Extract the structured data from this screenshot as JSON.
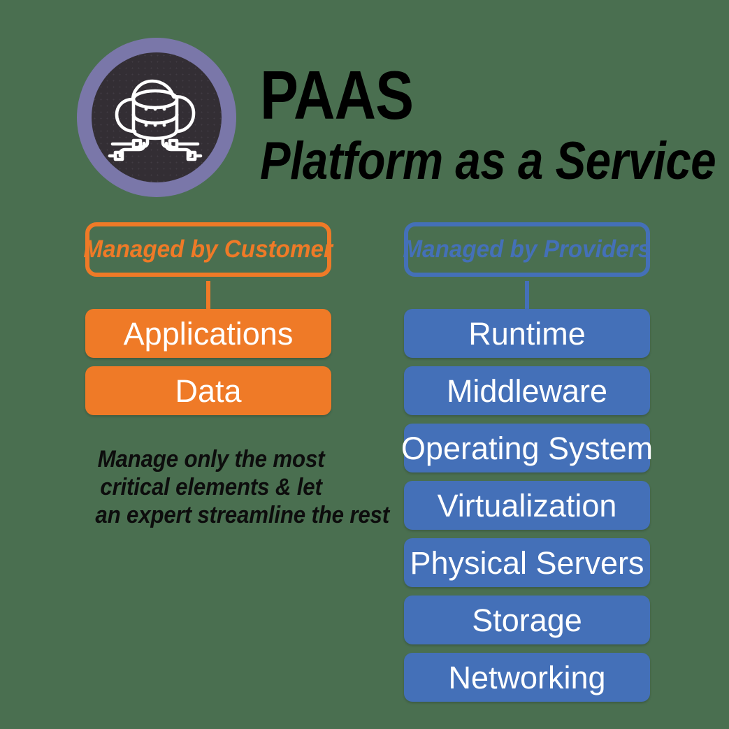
{
  "page": {
    "background_color": "#4a6f50",
    "title": "PaaS",
    "subtitle": "Platform as a Service"
  },
  "logo": {
    "icon_name": "cloud-database-network-icon",
    "ring_color": "#7a77a9",
    "disc_color": "#332e34",
    "glyph_color": "#ffffff"
  },
  "columns": [
    {
      "id": "customer",
      "header_label": "Managed by Customer",
      "accent_color": "#ef7a27",
      "items": [
        {
          "label": "Applications"
        },
        {
          "label": "Data"
        }
      ]
    },
    {
      "id": "provider",
      "header_label": "Managed by Providers",
      "accent_color": "#4470b8",
      "items": [
        {
          "label": "Runtime"
        },
        {
          "label": "Middleware"
        },
        {
          "label": "Operating System"
        },
        {
          "label": "Virtualization"
        },
        {
          "label": "Physical Servers"
        },
        {
          "label": "Storage"
        },
        {
          "label": "Networking"
        }
      ]
    }
  ],
  "tagline": {
    "line1": "Manage only the most",
    "line2": "critical elements & let",
    "line3": "an expert streamline the rest"
  }
}
